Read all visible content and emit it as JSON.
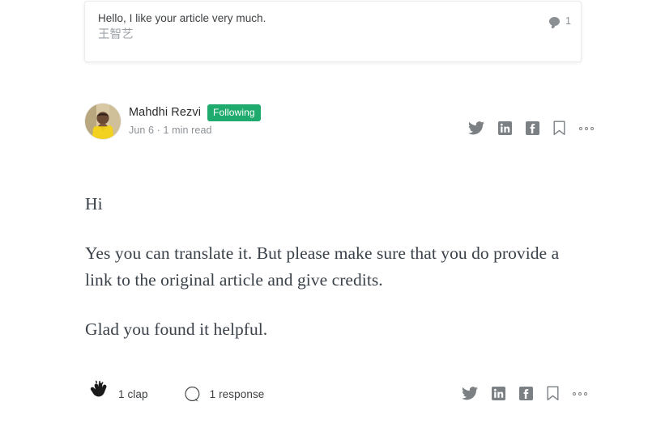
{
  "quoted_comment": {
    "text": "Hello, I like your article very much.",
    "author": "王智艺",
    "reply_count": "1",
    "bubble_icon": "comment-bubble-filled-icon"
  },
  "byline": {
    "author_name": "Mahdhi Rezvi",
    "follow_state_label": "Following",
    "meta": "Jun 6 · 1 min read",
    "avatar_alt": "avatar"
  },
  "share": {
    "twitter_label": "twitter-icon",
    "linkedin_label": "linkedin-icon",
    "facebook_label": "facebook-icon",
    "bookmark_label": "bookmark-icon",
    "more_label": "more-options-icon"
  },
  "article": {
    "paragraphs": [
      "Hi",
      "Yes you can translate it. But please make sure that you do provide a link to the original article and give credits.",
      "Glad you found it helpful."
    ]
  },
  "actions": {
    "clap_label": "1 clap",
    "response_label": "1 response",
    "clap_icon": "clap-icon",
    "response_icon": "comment-bubble-outline-icon"
  },
  "colors": {
    "following_green": "#1fab6e",
    "icon_gray": "#7b8084",
    "body_text": "#3a4149",
    "muted_text": "#8c9196"
  }
}
